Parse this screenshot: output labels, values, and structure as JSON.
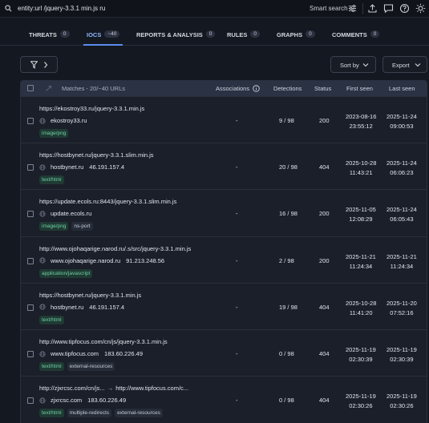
{
  "search": {
    "query": "entity:url /jquery-3.3.1 min.js ru",
    "smart_search_label": "Smart search"
  },
  "tabs": [
    {
      "label": "THREATS",
      "count": "0"
    },
    {
      "label": "IOCS",
      "count": "~40"
    },
    {
      "label": "REPORTS & ANALYSIS",
      "count": "0"
    },
    {
      "label": "RULES",
      "count": "0"
    },
    {
      "label": "GRAPHS",
      "count": "0"
    },
    {
      "label": "COMMENTS",
      "count": "0"
    }
  ],
  "toolbar": {
    "sort_label": "Sort by",
    "export_label": "Export"
  },
  "table": {
    "columns": {
      "matches": "Matches - 20/~40 URLs",
      "associations": "Associations",
      "detections": "Detections",
      "status": "Status",
      "first_seen": "First seen",
      "last_seen": "Last seen"
    },
    "rows": [
      {
        "url": "https://ekostroy33.ru/jquery-3.3.1.min.js",
        "domain": "ekostroy33.ru",
        "ip": "",
        "tags": [
          {
            "text": "image/png",
            "style": "green"
          }
        ],
        "associations": "-",
        "detections": "9 / 98",
        "status": "200",
        "first_date": "2023-08-16",
        "first_time": "23:55:12",
        "last_date": "2025-11-24",
        "last_time": "09:00:53"
      },
      {
        "url": "https://hostbynet.ru/jquery-3.3.1.slim.min.js",
        "domain": "hostbynet.ru",
        "ip": "46.191.157.4",
        "tags": [
          {
            "text": "text/html",
            "style": "green"
          }
        ],
        "associations": "-",
        "detections": "20 / 98",
        "status": "404",
        "first_date": "2025-10-28",
        "first_time": "11:43:21",
        "last_date": "2025-11-24",
        "last_time": "06:06:23"
      },
      {
        "url": "https://update.ecols.ru:8443/jquery-3.3.1.slim.min.js",
        "domain": "update.ecols.ru",
        "ip": "",
        "tags": [
          {
            "text": "image/png",
            "style": "green"
          },
          {
            "text": "ns-port",
            "style": "plain"
          }
        ],
        "associations": "-",
        "detections": "16 / 98",
        "status": "200",
        "first_date": "2025-11-05",
        "first_time": "12:08:29",
        "last_date": "2025-11-24",
        "last_time": "06:05:43"
      },
      {
        "url": "http://www.ojohaqarige.narod.ru/.s/src/jquery-3.3.1.min.js",
        "domain": "www.ojohaqarige.narod.ru",
        "ip": "91.213.248.56",
        "tags": [
          {
            "text": "application/javascript",
            "style": "green"
          }
        ],
        "associations": "-",
        "detections": "2 / 98",
        "status": "200",
        "first_date": "2025-11-21",
        "first_time": "11:24:34",
        "last_date": "2025-11-21",
        "last_time": "11:24:34"
      },
      {
        "url": "https://hostbynet.ru/jquery-3.3.1.min.js",
        "domain": "hostbynet.ru",
        "ip": "46.191.157.4",
        "tags": [
          {
            "text": "text/html",
            "style": "green"
          }
        ],
        "associations": "-",
        "detections": "19 / 98",
        "status": "404",
        "first_date": "2025-10-28",
        "first_time": "11:41:20",
        "last_date": "2025-11-20",
        "last_time": "07:52:16"
      },
      {
        "url": "http://www.tipfocus.com/cn/js/jquery-3.3.1.min.js",
        "domain": "www.tipfocus.com",
        "ip": "183.60.226.49",
        "tags": [
          {
            "text": "text/html",
            "style": "green"
          },
          {
            "text": "external-resources",
            "style": "plain"
          }
        ],
        "associations": "-",
        "detections": "0 / 98",
        "status": "404",
        "first_date": "2025-11-19",
        "first_time": "02:30:39",
        "last_date": "2025-11-19",
        "last_time": "02:30:39"
      },
      {
        "url": "http://zjxrcsc.com/cn/js...",
        "redirect": "http://www.tipfocus.com/c...",
        "domain": "zjxrcsc.com",
        "ip": "183.60.226.49",
        "tags": [
          {
            "text": "text/html",
            "style": "green"
          },
          {
            "text": "multiple-redirects",
            "style": "plain"
          },
          {
            "text": "external-resources",
            "style": "plain"
          }
        ],
        "associations": "-",
        "detections": "0 / 98",
        "status": "404",
        "first_date": "2025-11-19",
        "first_time": "02:30:26",
        "last_date": "2025-11-19",
        "last_time": "02:30:26"
      }
    ]
  }
}
